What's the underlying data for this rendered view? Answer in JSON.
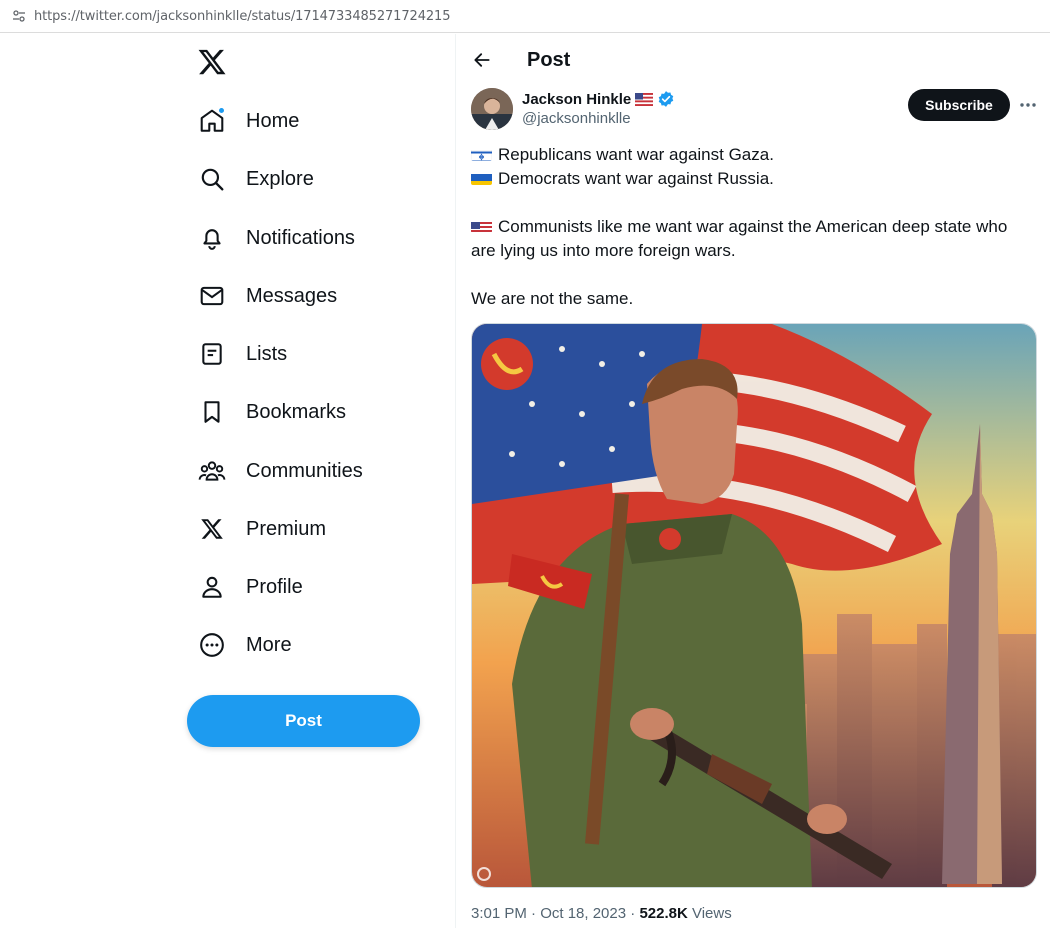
{
  "browser": {
    "url": "https://twitter.com/jacksonhinklle/status/1714733485271724215"
  },
  "sidebar": {
    "logo": "x-logo",
    "items": [
      {
        "label": "Home",
        "icon": "home-icon",
        "notification": true
      },
      {
        "label": "Explore",
        "icon": "search-icon"
      },
      {
        "label": "Notifications",
        "icon": "bell-icon"
      },
      {
        "label": "Messages",
        "icon": "envelope-icon"
      },
      {
        "label": "Lists",
        "icon": "list-icon"
      },
      {
        "label": "Bookmarks",
        "icon": "bookmark-icon"
      },
      {
        "label": "Communities",
        "icon": "people-icon"
      },
      {
        "label": "Premium",
        "icon": "x-logo-icon"
      },
      {
        "label": "Profile",
        "icon": "person-icon"
      },
      {
        "label": "More",
        "icon": "more-circle-icon"
      }
    ],
    "post_button": "Post"
  },
  "header": {
    "title": "Post"
  },
  "tweet": {
    "author": {
      "name": "Jackson Hinkle",
      "handle": "@jacksonhinklle",
      "verified": true
    },
    "subscribe_label": "Subscribe",
    "lines": [
      {
        "flag": "israel",
        "text": "Republicans want war against Gaza."
      },
      {
        "flag": "ukraine",
        "text": "Democrats want war against Russia."
      },
      {
        "flag": "usa",
        "text": "Communists like me want war against the American deep state who are lying us into more foreign wars."
      },
      {
        "text": "We are not the same."
      }
    ],
    "time": "3:01 PM · Oct 18, 2023",
    "views_count": "522.8K",
    "views_label": "Views"
  },
  "colors": {
    "accent": "#1d9bf0",
    "text": "#0f1419",
    "muted": "#536471"
  }
}
